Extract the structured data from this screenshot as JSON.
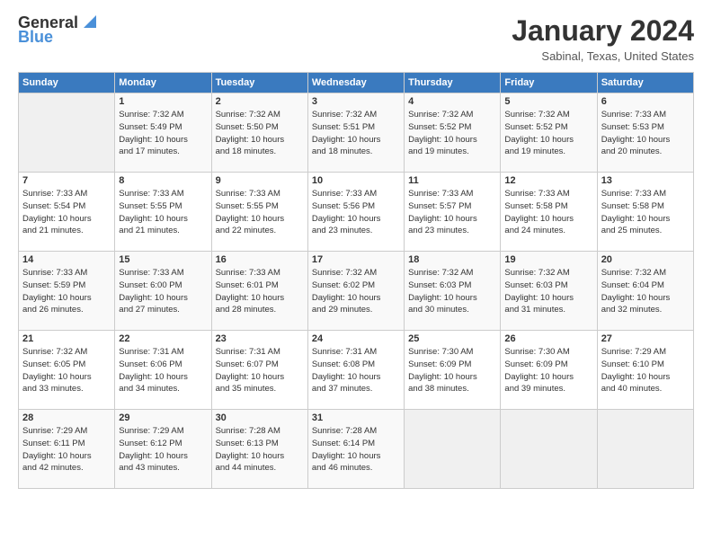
{
  "logo": {
    "line1": "General",
    "line2": "Blue"
  },
  "header": {
    "month_year": "January 2024",
    "location": "Sabinal, Texas, United States"
  },
  "days_of_week": [
    "Sunday",
    "Monday",
    "Tuesday",
    "Wednesday",
    "Thursday",
    "Friday",
    "Saturday"
  ],
  "weeks": [
    [
      {
        "day": "",
        "info": ""
      },
      {
        "day": "1",
        "info": "Sunrise: 7:32 AM\nSunset: 5:49 PM\nDaylight: 10 hours\nand 17 minutes."
      },
      {
        "day": "2",
        "info": "Sunrise: 7:32 AM\nSunset: 5:50 PM\nDaylight: 10 hours\nand 18 minutes."
      },
      {
        "day": "3",
        "info": "Sunrise: 7:32 AM\nSunset: 5:51 PM\nDaylight: 10 hours\nand 18 minutes."
      },
      {
        "day": "4",
        "info": "Sunrise: 7:32 AM\nSunset: 5:52 PM\nDaylight: 10 hours\nand 19 minutes."
      },
      {
        "day": "5",
        "info": "Sunrise: 7:32 AM\nSunset: 5:52 PM\nDaylight: 10 hours\nand 19 minutes."
      },
      {
        "day": "6",
        "info": "Sunrise: 7:33 AM\nSunset: 5:53 PM\nDaylight: 10 hours\nand 20 minutes."
      }
    ],
    [
      {
        "day": "7",
        "info": "Sunrise: 7:33 AM\nSunset: 5:54 PM\nDaylight: 10 hours\nand 21 minutes."
      },
      {
        "day": "8",
        "info": "Sunrise: 7:33 AM\nSunset: 5:55 PM\nDaylight: 10 hours\nand 21 minutes."
      },
      {
        "day": "9",
        "info": "Sunrise: 7:33 AM\nSunset: 5:55 PM\nDaylight: 10 hours\nand 22 minutes."
      },
      {
        "day": "10",
        "info": "Sunrise: 7:33 AM\nSunset: 5:56 PM\nDaylight: 10 hours\nand 23 minutes."
      },
      {
        "day": "11",
        "info": "Sunrise: 7:33 AM\nSunset: 5:57 PM\nDaylight: 10 hours\nand 23 minutes."
      },
      {
        "day": "12",
        "info": "Sunrise: 7:33 AM\nSunset: 5:58 PM\nDaylight: 10 hours\nand 24 minutes."
      },
      {
        "day": "13",
        "info": "Sunrise: 7:33 AM\nSunset: 5:58 PM\nDaylight: 10 hours\nand 25 minutes."
      }
    ],
    [
      {
        "day": "14",
        "info": "Sunrise: 7:33 AM\nSunset: 5:59 PM\nDaylight: 10 hours\nand 26 minutes."
      },
      {
        "day": "15",
        "info": "Sunrise: 7:33 AM\nSunset: 6:00 PM\nDaylight: 10 hours\nand 27 minutes."
      },
      {
        "day": "16",
        "info": "Sunrise: 7:33 AM\nSunset: 6:01 PM\nDaylight: 10 hours\nand 28 minutes."
      },
      {
        "day": "17",
        "info": "Sunrise: 7:32 AM\nSunset: 6:02 PM\nDaylight: 10 hours\nand 29 minutes."
      },
      {
        "day": "18",
        "info": "Sunrise: 7:32 AM\nSunset: 6:03 PM\nDaylight: 10 hours\nand 30 minutes."
      },
      {
        "day": "19",
        "info": "Sunrise: 7:32 AM\nSunset: 6:03 PM\nDaylight: 10 hours\nand 31 minutes."
      },
      {
        "day": "20",
        "info": "Sunrise: 7:32 AM\nSunset: 6:04 PM\nDaylight: 10 hours\nand 32 minutes."
      }
    ],
    [
      {
        "day": "21",
        "info": "Sunrise: 7:32 AM\nSunset: 6:05 PM\nDaylight: 10 hours\nand 33 minutes."
      },
      {
        "day": "22",
        "info": "Sunrise: 7:31 AM\nSunset: 6:06 PM\nDaylight: 10 hours\nand 34 minutes."
      },
      {
        "day": "23",
        "info": "Sunrise: 7:31 AM\nSunset: 6:07 PM\nDaylight: 10 hours\nand 35 minutes."
      },
      {
        "day": "24",
        "info": "Sunrise: 7:31 AM\nSunset: 6:08 PM\nDaylight: 10 hours\nand 37 minutes."
      },
      {
        "day": "25",
        "info": "Sunrise: 7:30 AM\nSunset: 6:09 PM\nDaylight: 10 hours\nand 38 minutes."
      },
      {
        "day": "26",
        "info": "Sunrise: 7:30 AM\nSunset: 6:09 PM\nDaylight: 10 hours\nand 39 minutes."
      },
      {
        "day": "27",
        "info": "Sunrise: 7:29 AM\nSunset: 6:10 PM\nDaylight: 10 hours\nand 40 minutes."
      }
    ],
    [
      {
        "day": "28",
        "info": "Sunrise: 7:29 AM\nSunset: 6:11 PM\nDaylight: 10 hours\nand 42 minutes."
      },
      {
        "day": "29",
        "info": "Sunrise: 7:29 AM\nSunset: 6:12 PM\nDaylight: 10 hours\nand 43 minutes."
      },
      {
        "day": "30",
        "info": "Sunrise: 7:28 AM\nSunset: 6:13 PM\nDaylight: 10 hours\nand 44 minutes."
      },
      {
        "day": "31",
        "info": "Sunrise: 7:28 AM\nSunset: 6:14 PM\nDaylight: 10 hours\nand 46 minutes."
      },
      {
        "day": "",
        "info": ""
      },
      {
        "day": "",
        "info": ""
      },
      {
        "day": "",
        "info": ""
      }
    ]
  ]
}
